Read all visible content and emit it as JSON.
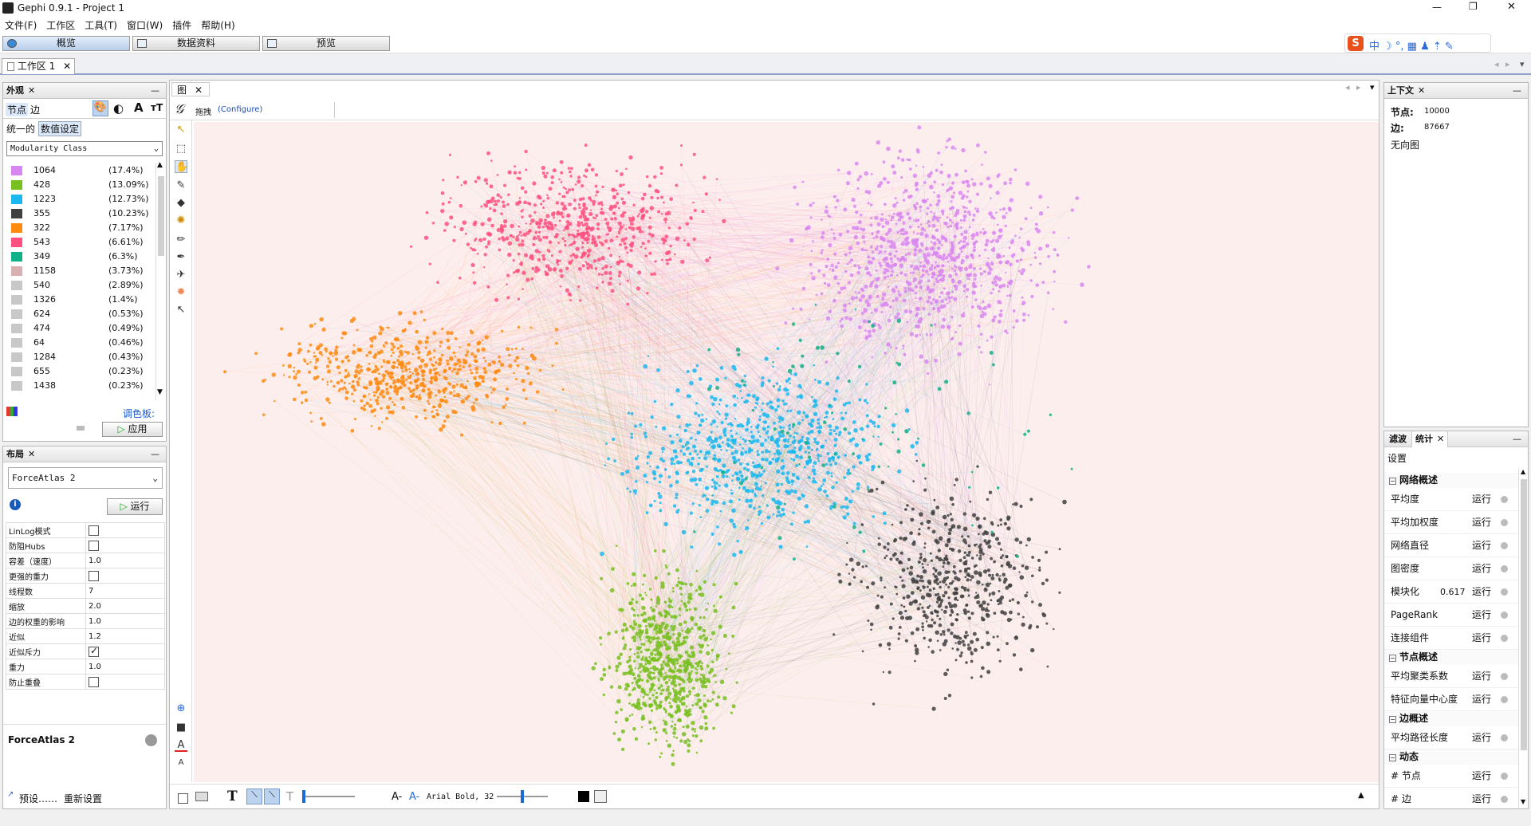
{
  "window": {
    "title": "Gephi 0.9.1 - Project 1",
    "controls": [
      "—",
      "❐",
      "✕"
    ]
  },
  "menu": [
    "文件(F)",
    "工作区",
    "工具(T)",
    "窗口(W)",
    "插件",
    "帮助(H)"
  ],
  "modes": [
    "概览",
    "数据资料",
    "预览"
  ],
  "workspace_tab": {
    "label": "工作区 1"
  },
  "appearance": {
    "title": "外观",
    "tabs": [
      "节点",
      "边"
    ],
    "subtabs": [
      "统一的",
      "数值设定"
    ],
    "attribute": "Modularity Class",
    "palette_label": "调色板:",
    "apply": "应用",
    "items": [
      {
        "count": "1064",
        "pct": "(17.4%)",
        "color": "#d987f0"
      },
      {
        "count": "428",
        "pct": "(13.09%)",
        "color": "#78c020"
      },
      {
        "count": "1223",
        "pct": "(12.73%)",
        "color": "#1ab8ee"
      },
      {
        "count": "355",
        "pct": "(10.23%)",
        "color": "#404040"
      },
      {
        "count": "322",
        "pct": "(7.17%)",
        "color": "#ff8a10"
      },
      {
        "count": "543",
        "pct": "(6.61%)",
        "color": "#ff5080"
      },
      {
        "count": "349",
        "pct": "(6.3%)",
        "color": "#10b088"
      },
      {
        "count": "1158",
        "pct": "(3.73%)",
        "color": "#d8b0b0"
      },
      {
        "count": "540",
        "pct": "(2.89%)",
        "color": "#c8c8c8"
      },
      {
        "count": "1326",
        "pct": "(1.4%)",
        "color": "#c8c8c8"
      },
      {
        "count": "624",
        "pct": "(0.53%)",
        "color": "#c8c8c8"
      },
      {
        "count": "474",
        "pct": "(0.49%)",
        "color": "#c8c8c8"
      },
      {
        "count": "64",
        "pct": "(0.46%)",
        "color": "#c8c8c8"
      },
      {
        "count": "1284",
        "pct": "(0.43%)",
        "color": "#c8c8c8"
      },
      {
        "count": "655",
        "pct": "(0.23%)",
        "color": "#c8c8c8"
      },
      {
        "count": "1438",
        "pct": "(0.23%)",
        "color": "#c8c8c8"
      }
    ]
  },
  "layout": {
    "title": "布局",
    "algorithm": "ForceAtlas 2",
    "run": "运行",
    "footer_name": "ForceAtlas 2",
    "presets": "预设……",
    "reset": "重新设置",
    "params": [
      {
        "label": "LinLog模式",
        "type": "check",
        "checked": false,
        "value": ""
      },
      {
        "label": "防阻Hubs",
        "type": "check",
        "checked": false,
        "value": ""
      },
      {
        "label": "容差（速度）",
        "type": "text",
        "checked": false,
        "value": "1.0"
      },
      {
        "label": "更强的重力",
        "type": "check",
        "checked": false,
        "value": ""
      },
      {
        "label": "线程数",
        "type": "text",
        "checked": false,
        "value": "7"
      },
      {
        "label": "缩放",
        "type": "text",
        "checked": false,
        "value": "2.0"
      },
      {
        "label": "边的权重的影响",
        "type": "text",
        "checked": false,
        "value": "1.0"
      },
      {
        "label": "近似",
        "type": "text",
        "checked": false,
        "value": "1.2"
      },
      {
        "label": "近似斥力",
        "type": "check",
        "checked": true,
        "value": ""
      },
      {
        "label": "重力",
        "type": "text",
        "checked": false,
        "value": "1.0"
      },
      {
        "label": "防止重叠",
        "type": "check",
        "checked": false,
        "value": ""
      }
    ]
  },
  "graph": {
    "tab": "图",
    "tool": "拖拽",
    "configure": "(Configure)",
    "font": "Arial Bold, 32",
    "bg": "#fdeeee"
  },
  "context": {
    "title": "上下文",
    "nodes_label": "节点:",
    "nodes": "10000",
    "edges_label": "边:",
    "edges": "87667",
    "type": "无向图"
  },
  "stats": {
    "tabs": [
      "滤波",
      "统计"
    ],
    "settings": "设置",
    "run": "运行",
    "sections": [
      {
        "title": "网络概述",
        "items": [
          {
            "label": "平均度",
            "value": ""
          },
          {
            "label": "平均加权度",
            "value": ""
          },
          {
            "label": "网络直径",
            "value": ""
          },
          {
            "label": "图密度",
            "value": ""
          },
          {
            "label": "模块化",
            "value": "0.617"
          },
          {
            "label": "PageRank",
            "value": ""
          },
          {
            "label": "连接组件",
            "value": ""
          }
        ]
      },
      {
        "title": "节点概述",
        "items": [
          {
            "label": "平均聚类系数",
            "value": ""
          },
          {
            "label": "特征向量中心度",
            "value": ""
          }
        ]
      },
      {
        "title": "边概述",
        "items": [
          {
            "label": "平均路径长度",
            "value": ""
          }
        ]
      },
      {
        "title": "动态",
        "items": [
          {
            "label": "# 节点",
            "value": ""
          },
          {
            "label": "# 边",
            "value": ""
          }
        ]
      }
    ]
  }
}
